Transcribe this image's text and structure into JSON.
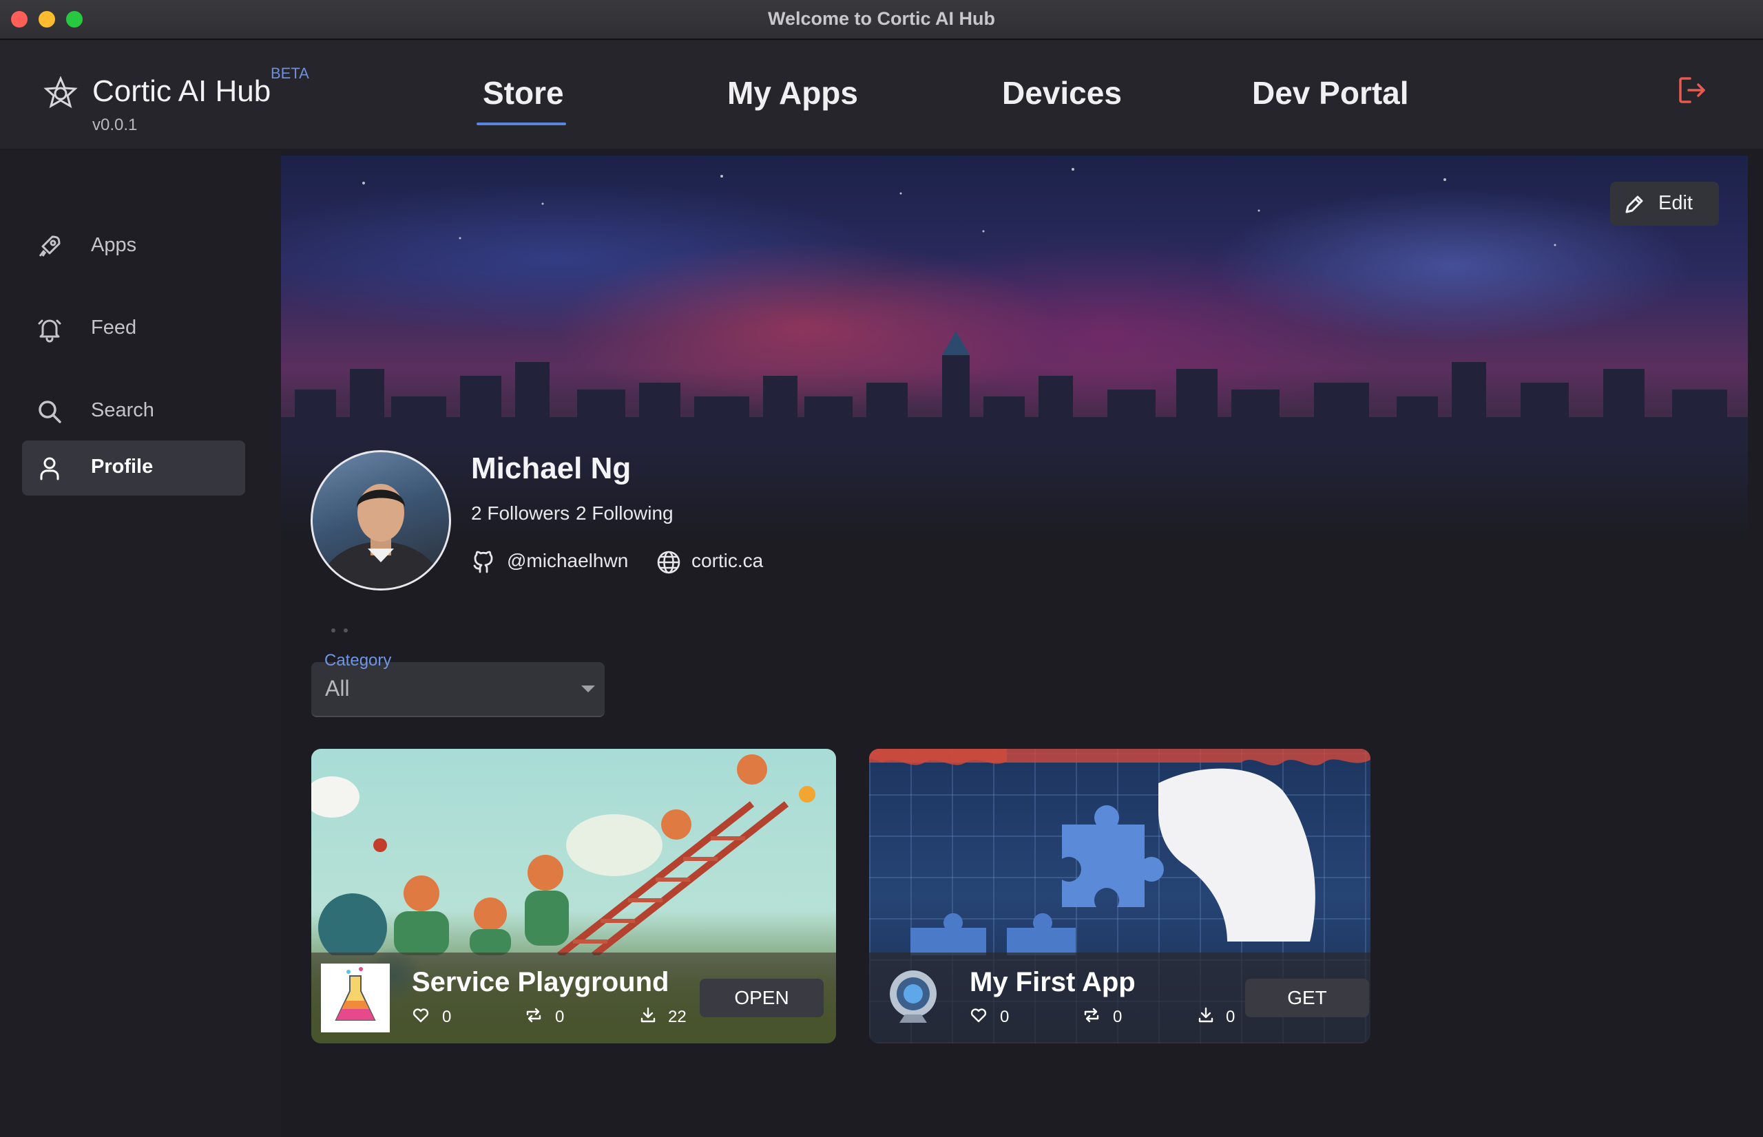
{
  "window": {
    "title": "Welcome to Cortic AI Hub"
  },
  "header": {
    "app_name": "Cortic AI Hub",
    "badge": "BETA",
    "version": "v0.0.1",
    "tabs": [
      {
        "label": "Store",
        "active": true
      },
      {
        "label": "My Apps",
        "active": false
      },
      {
        "label": "Devices",
        "active": false
      },
      {
        "label": "Dev Portal",
        "active": false
      }
    ],
    "logout_icon": "logout-icon"
  },
  "sidebar": {
    "items": [
      {
        "label": "Apps",
        "icon": "rocket-icon",
        "active": false
      },
      {
        "label": "Feed",
        "icon": "bell-icon",
        "active": false
      },
      {
        "label": "Search",
        "icon": "search-icon",
        "active": false
      },
      {
        "label": "Profile",
        "icon": "user-icon",
        "active": true
      }
    ]
  },
  "profile": {
    "edit_label": "Edit",
    "name": "Michael Ng",
    "followers": "2 Followers",
    "following": "2 Following",
    "github": "@michaelhwn",
    "website": "cortic.ca"
  },
  "filter": {
    "label": "Category",
    "value": "All"
  },
  "apps": [
    {
      "title": "Service Playground",
      "likes": "0",
      "reposts": "0",
      "downloads": "22",
      "action": "OPEN"
    },
    {
      "title": "My First App",
      "likes": "0",
      "reposts": "0",
      "downloads": "0",
      "action": "GET"
    }
  ],
  "colors": {
    "accent": "#5a86e0",
    "logout": "#e85a4f",
    "background": "#1c1c22",
    "sidebar_active": "#36363e"
  }
}
